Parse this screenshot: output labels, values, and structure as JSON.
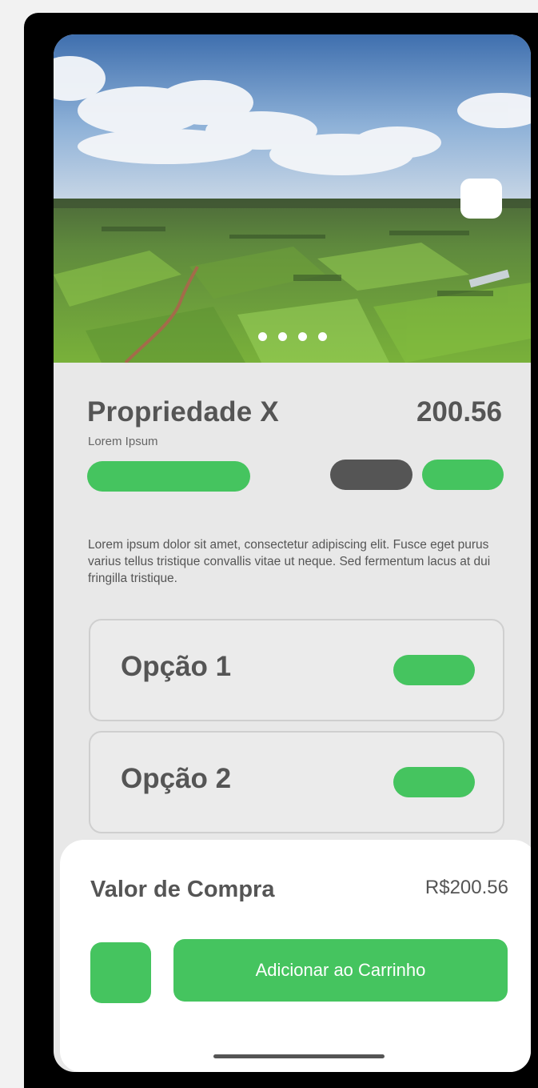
{
  "product": {
    "title": "Propriedade X",
    "subtitle": "Lorem Ipsum",
    "price": "200.56",
    "description": "Lorem ipsum dolor sit amet, consectetur adipiscing elit. Fusce eget purus varius tellus tristique convallis vitae ut neque. Sed fermentum lacus at dui fringilla tristique."
  },
  "carousel": {
    "slide_count": 4,
    "image": "aerial-farmland-photo"
  },
  "options": [
    {
      "label": "Opção 1"
    },
    {
      "label": "Opção 2"
    }
  ],
  "purchase": {
    "label": "Valor de Compra",
    "total": "R$200.56",
    "add_to_cart_label": "Adicionar ao Carrinho"
  },
  "colors": {
    "accent": "#45c45f",
    "dark_pill": "#555555",
    "text": "#555555"
  }
}
